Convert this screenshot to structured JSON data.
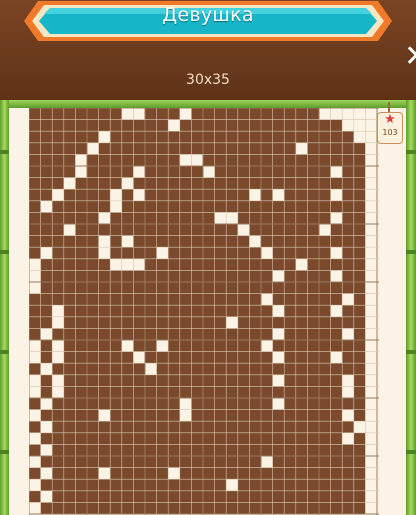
{
  "header": {
    "title": "Девушка",
    "size_label": "30x35"
  },
  "close_icon": "close-icon",
  "badge": {
    "icon": "star-icon",
    "value": "103"
  },
  "colors": {
    "filled": "#7b4a2d",
    "empty": "#fbf4e6",
    "grid_line": "#d9c6ad",
    "major_line": "#9c7a5c"
  },
  "puzzle": {
    "columns": 30,
    "rows": 35,
    "cells": [
      "11111111001110111111111110000",
      "11111111111101111111111111100",
      "11111101111111111111111111110",
      "11111011111111111111111011111",
      "11110111111110011111111111111",
      "11110111101111101111111111011",
      "11101111011111111111111111111",
      "11011110101111111110101111011",
      "10111110111111111111111111111",
      "11111101111111110011111111011",
      "11101111111111111101111110111",
      "11111101011111111110111111111",
      "10111101111011111111011111011",
      "01111110001111111111111011111",
      "01111111111111111111101111011",
      "01111111111111111111111111111",
      "11111111111111111111011111101",
      "11011111111111111111101111011",
      "11011111111111111011111111111",
      "10111111111111111111101111101",
      "01011111011011111111011111111",
      "01011111101111111111101111011",
      "10111111110111111111111111111",
      "01011111111111111111101111101",
      "01011111111111111111111111101",
      "10111111111110111111101111111",
      "01111101111110111111111111101",
      "10111111111111111111111111110",
      "01111111111111111111111111101",
      "10111111111111111111111111111",
      "01111111111111111111011111111",
      "10111101111101111111111111111",
      "01111111111111111011111111111",
      "10111111111111111111111111111",
      "01111111111111111111111111111"
    ]
  }
}
